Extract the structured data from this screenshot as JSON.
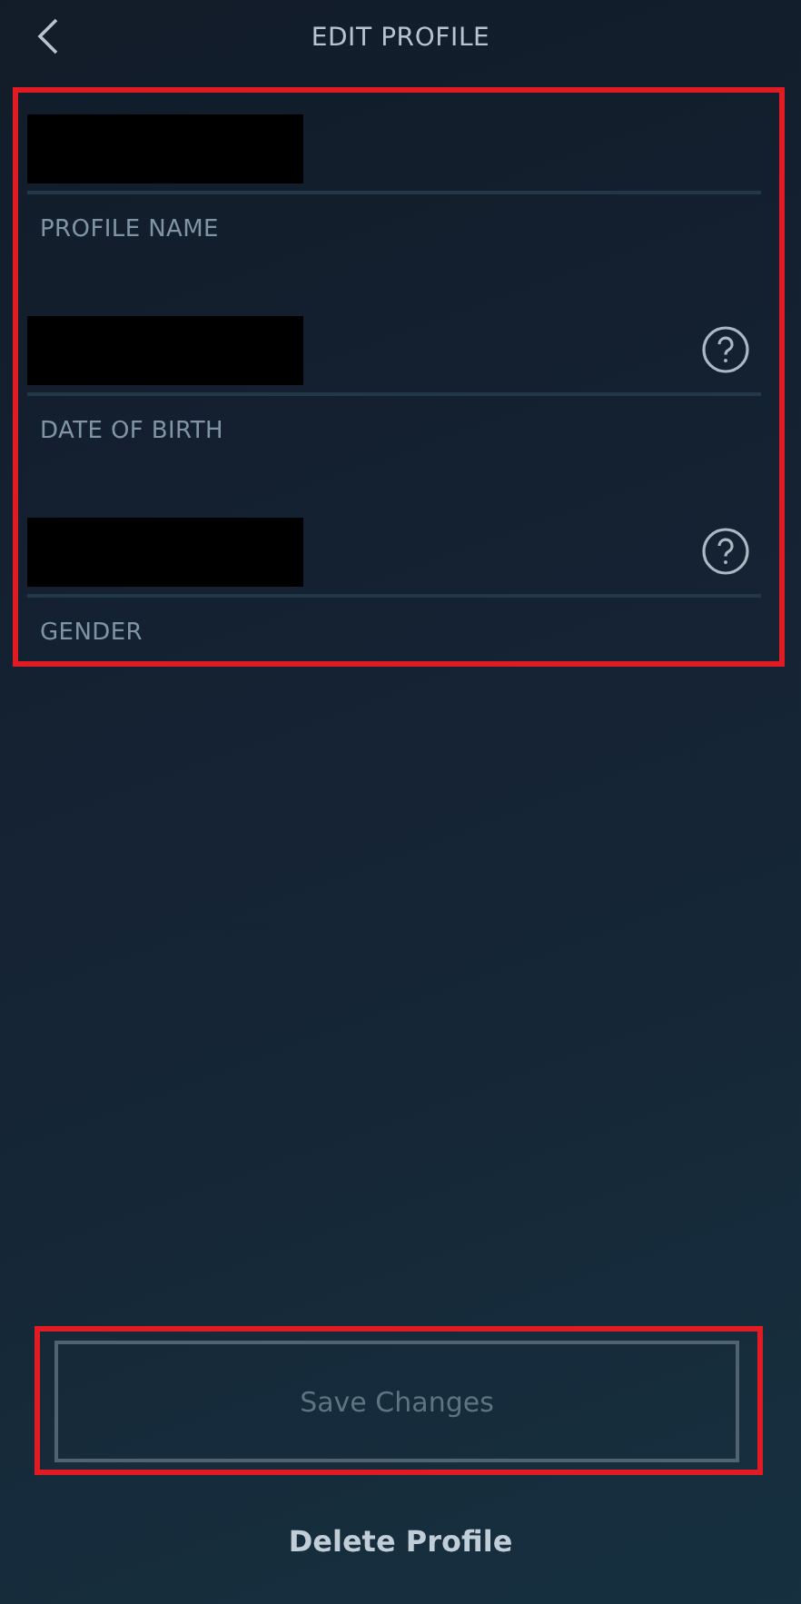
{
  "header": {
    "title": "EDIT PROFILE"
  },
  "fields": [
    {
      "label": "PROFILE NAME",
      "redacted": true,
      "help": false
    },
    {
      "label": "DATE OF BIRTH",
      "redacted": true,
      "help": true
    },
    {
      "label": "GENDER",
      "redacted": true,
      "help": true
    }
  ],
  "save_button": {
    "label": "Save Changes",
    "disabled": true
  },
  "delete_link": {
    "label": "Delete Profile"
  }
}
